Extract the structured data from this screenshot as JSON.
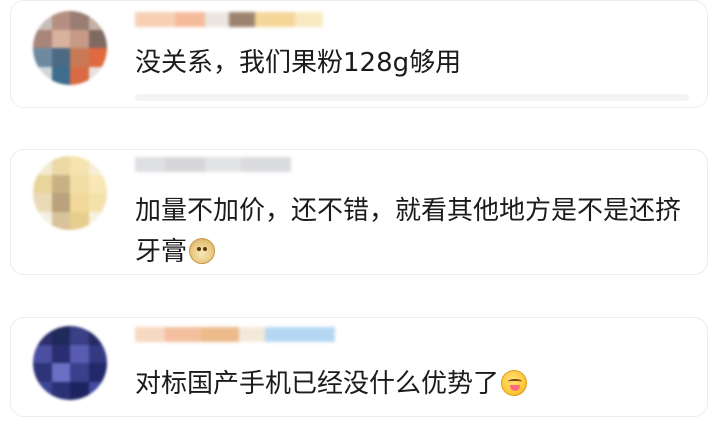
{
  "comments": [
    {
      "text": "没关系，我们果粉128g够用",
      "emoji": ""
    },
    {
      "text": "加量不加价，还不错，就看其他地方是不是还挤牙膏",
      "emoji": "doge-emoji"
    },
    {
      "text": "对标国产手机已经没什么优势了",
      "emoji": "yum-face-emoji"
    }
  ],
  "colors": {
    "card_border": "#ececec",
    "text": "#1b1b1b",
    "background": "#ffffff"
  }
}
